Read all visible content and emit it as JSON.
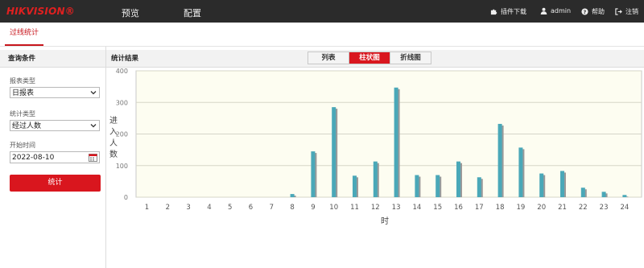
{
  "header": {
    "logo": "HIKVISION®",
    "nav": [
      "预览",
      "配置"
    ],
    "plugin_download": "插件下载",
    "user": "admin",
    "help": "帮助",
    "logout": "注销"
  },
  "subnav": {
    "active_tab": "过线统计"
  },
  "query": {
    "title": "查询条件",
    "report_type_label": "报表类型",
    "report_type_value": "日报表",
    "stat_type_label": "统计类型",
    "stat_type_value": "经过人数",
    "start_time_label": "开始时间",
    "start_time_value": "2022-08-10",
    "submit_label": "统计"
  },
  "result": {
    "title": "统计结果",
    "view_tabs": [
      "列表",
      "柱状图",
      "折线图"
    ],
    "active_view": "柱状图"
  },
  "colors": {
    "brand_red": "#d9161e",
    "bar": "#4aa8b8",
    "bar_shadow": "#9a9a9a",
    "plot_bg": "#fdfdf1"
  },
  "chart_data": {
    "type": "bar",
    "categories": [
      "1",
      "2",
      "3",
      "4",
      "5",
      "6",
      "7",
      "8",
      "9",
      "10",
      "11",
      "12",
      "13",
      "14",
      "15",
      "16",
      "17",
      "18",
      "19",
      "20",
      "21",
      "22",
      "23",
      "24"
    ],
    "values": [
      0,
      0,
      0,
      0,
      0,
      0,
      0,
      10,
      145,
      285,
      68,
      113,
      347,
      70,
      70,
      113,
      63,
      232,
      157,
      75,
      83,
      30,
      17,
      7
    ],
    "ylabel": "进入人数",
    "xlabel": "时",
    "ylim": [
      0,
      400
    ],
    "yticks": [
      0,
      100,
      200,
      300,
      400
    ],
    "grid": true
  }
}
